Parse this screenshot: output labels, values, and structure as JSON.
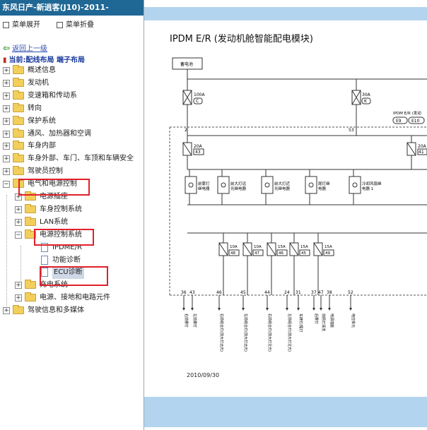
{
  "window_title": "东风日产-新逍客(J10)-2011-",
  "menu": {
    "expand": "菜单展开",
    "collapse": "菜单折叠"
  },
  "nav": {
    "back": "返回上一级",
    "current": "当前:配线布局 端子布局"
  },
  "tree": [
    {
      "label": "概述信息",
      "level": 0,
      "type": "folder",
      "expander": "+"
    },
    {
      "label": "发动机",
      "level": 0,
      "type": "folder",
      "expander": "+"
    },
    {
      "label": "变速箱和传动系",
      "level": 0,
      "type": "folder",
      "expander": "+"
    },
    {
      "label": "转向",
      "level": 0,
      "type": "folder",
      "expander": "+"
    },
    {
      "label": "保护系统",
      "level": 0,
      "type": "folder",
      "expander": "+"
    },
    {
      "label": "通风、加热器和空调",
      "level": 0,
      "type": "folder",
      "expander": "+"
    },
    {
      "label": "车身内部",
      "level": 0,
      "type": "folder",
      "expander": "+"
    },
    {
      "label": "车身外部、车门、车顶和车辆安全",
      "level": 0,
      "type": "folder",
      "expander": "+"
    },
    {
      "label": "驾驶员控制",
      "level": 0,
      "type": "folder",
      "expander": "+"
    },
    {
      "label": "电气和电源控制",
      "level": 0,
      "type": "folder",
      "expander": "-"
    },
    {
      "label": "电源插座",
      "level": 1,
      "type": "folder",
      "expander": "+"
    },
    {
      "label": "车身控制系统",
      "level": 1,
      "type": "folder",
      "expander": "+"
    },
    {
      "label": "LAN系统",
      "level": 1,
      "type": "folder",
      "expander": "+"
    },
    {
      "label": "电源控制系统",
      "level": 1,
      "type": "folder",
      "expander": "-"
    },
    {
      "label": "IPDME/R",
      "level": 2,
      "type": "doc",
      "expander": ""
    },
    {
      "label": "功能诊断",
      "level": 2,
      "type": "doc",
      "expander": ""
    },
    {
      "label": "ECU诊断",
      "level": 2,
      "type": "doc",
      "expander": "",
      "selected": true
    },
    {
      "label": "充电系统",
      "level": 1,
      "type": "folder",
      "expander": "+"
    },
    {
      "label": "电源、接地和电路元件",
      "level": 1,
      "type": "folder",
      "expander": "+"
    },
    {
      "label": "驾驶信息和多媒体",
      "level": 0,
      "type": "folder",
      "expander": "+"
    }
  ],
  "diagram": {
    "title": "IPDM E/R (发动机舱智能配电模块)",
    "battery": "蓄电池",
    "fuse_main_1": {
      "amp": "100A",
      "code": "C"
    },
    "fuse_main_2": {
      "amp": "30A",
      "code": "K"
    },
    "module_label": "IPDM E/R (发动",
    "connectors": [
      "E9",
      "E10"
    ],
    "node_2": "2",
    "node_53": "53",
    "fuse_20a_1": {
      "amp": "20A",
      "code": "43"
    },
    "fuse_20a_2": {
      "amp": "20A",
      "code": "41"
    },
    "relays": [
      "前雾灯继电器",
      "前大灯远光继电器",
      "前大灯近光继电器",
      "尾灯继电器",
      "冷却风扇继电器 1"
    ],
    "fuses": [
      {
        "amp": "10A",
        "code": "48"
      },
      {
        "amp": "10A",
        "code": "47"
      },
      {
        "amp": "15A",
        "code": "46"
      },
      {
        "amp": "15A",
        "code": "45"
      },
      {
        "amp": "15A",
        "code": "49"
      }
    ],
    "pins": [
      "36",
      "43",
      "46",
      "45",
      "44",
      "24",
      "31",
      "37",
      "47",
      "38",
      "52"
    ],
    "outputs": [
      "右前雾灯",
      "左前雾灯",
      "右前组合灯(前大灯远光)",
      "左前组合灯(前大灯远光)",
      "右前组合灯(前大灯近光)",
      "左前组合灯(前大灯近光)",
      "车牌灯/尾灯",
      "后雾灯",
      "前照灯清洗",
      "电源插座",
      "电控单元"
    ],
    "date": "2010/09/30"
  },
  "colors": {
    "titlebar": "#1f6794",
    "band": "#b3d4ef",
    "highlight": "#e0202a"
  }
}
